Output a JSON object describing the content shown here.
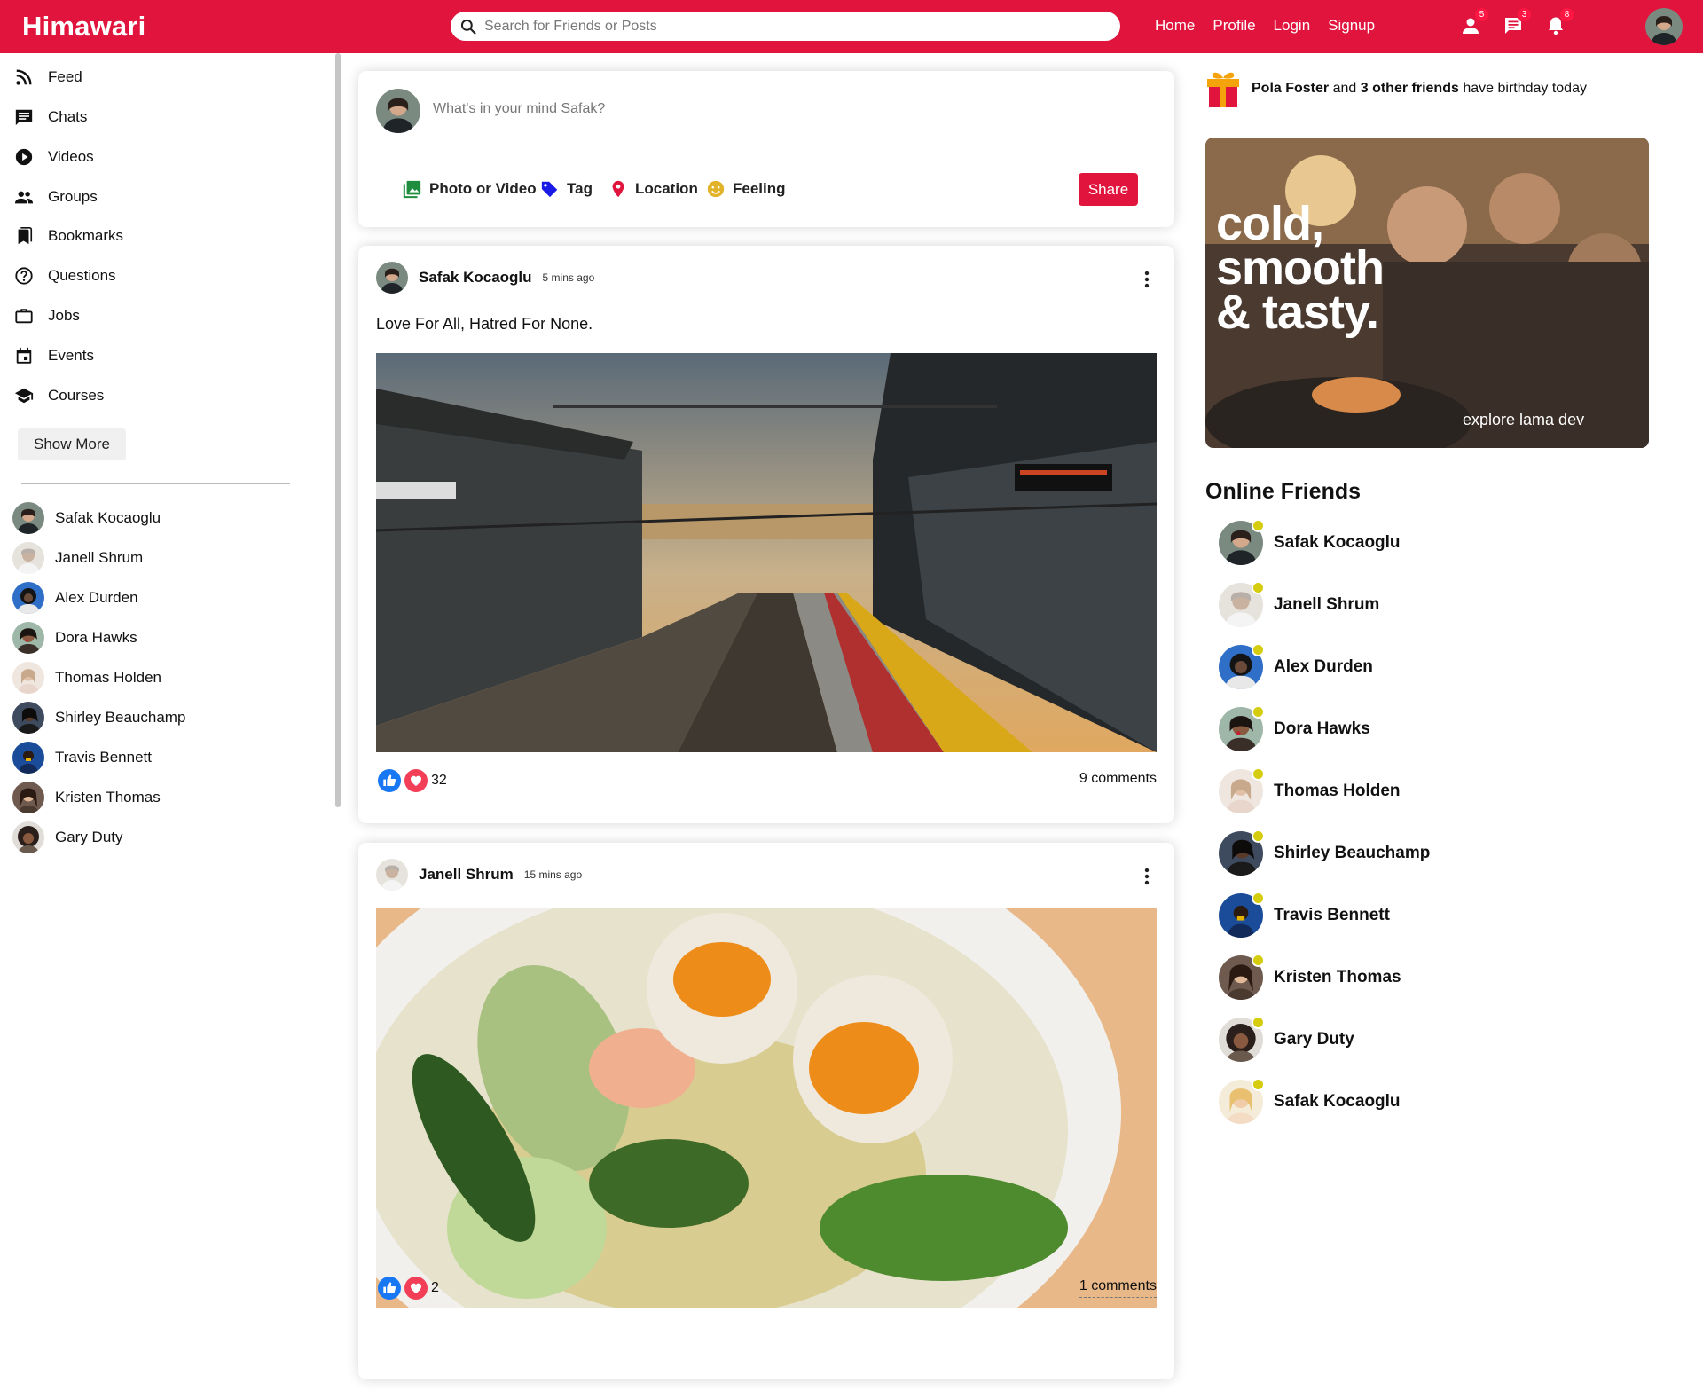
{
  "topbar": {
    "logo": "Himawari",
    "search_placeholder": "Search for Friends or Posts",
    "links": [
      "Home",
      "Profile",
      "Login",
      "Signup"
    ],
    "badges": {
      "friends": "5",
      "messages": "3",
      "notifications": "8"
    }
  },
  "sidebar": {
    "items": [
      {
        "label": "Feed",
        "icon": "rss-feed-icon"
      },
      {
        "label": "Chats",
        "icon": "chat-icon"
      },
      {
        "label": "Videos",
        "icon": "play-circle-icon"
      },
      {
        "label": "Groups",
        "icon": "group-icon"
      },
      {
        "label": "Bookmarks",
        "icon": "bookmark-icon"
      },
      {
        "label": "Questions",
        "icon": "help-circle-icon"
      },
      {
        "label": "Jobs",
        "icon": "briefcase-icon"
      },
      {
        "label": "Events",
        "icon": "calendar-icon"
      },
      {
        "label": "Courses",
        "icon": "school-icon"
      }
    ],
    "show_more": "Show More",
    "friends": [
      "Safak Kocaoglu",
      "Janell Shrum",
      "Alex Durden",
      "Dora Hawks",
      "Thomas Holden",
      "Shirley Beauchamp",
      "Travis Bennett",
      "Kristen Thomas",
      "Gary Duty"
    ]
  },
  "share": {
    "placeholder": "What's in your mind Safak?",
    "options": [
      "Photo or Video",
      "Tag",
      "Location",
      "Feeling"
    ],
    "button": "Share"
  },
  "posts": [
    {
      "user": "Safak Kocaoglu",
      "time": "5 mins ago",
      "text": "Love For All, Hatred For None.",
      "likes": "32",
      "comments": "9 comments"
    },
    {
      "user": "Janell Shrum",
      "time": "15 mins ago",
      "text": "",
      "likes": "2",
      "comments": "1 comments"
    }
  ],
  "rightbar": {
    "birthday": {
      "name": "Pola Foster",
      "and": " and ",
      "others": "3 other friends",
      "rest": " have birthday today"
    },
    "ad": {
      "line1": "cold,",
      "line2": "smooth",
      "line3": "& tasty.",
      "tag": "explore lama dev"
    },
    "online_title": "Online Friends",
    "online": [
      "Safak Kocaoglu",
      "Janell Shrum",
      "Alex Durden",
      "Dora Hawks",
      "Thomas Holden",
      "Shirley Beauchamp",
      "Travis Bennett",
      "Kristen Thomas",
      "Gary Duty",
      "Safak Kocaoglu"
    ]
  },
  "colors": {
    "brand": "#e0143c",
    "online": "#d4cc0c",
    "like": "#1877f2",
    "heart": "#f33e58"
  }
}
